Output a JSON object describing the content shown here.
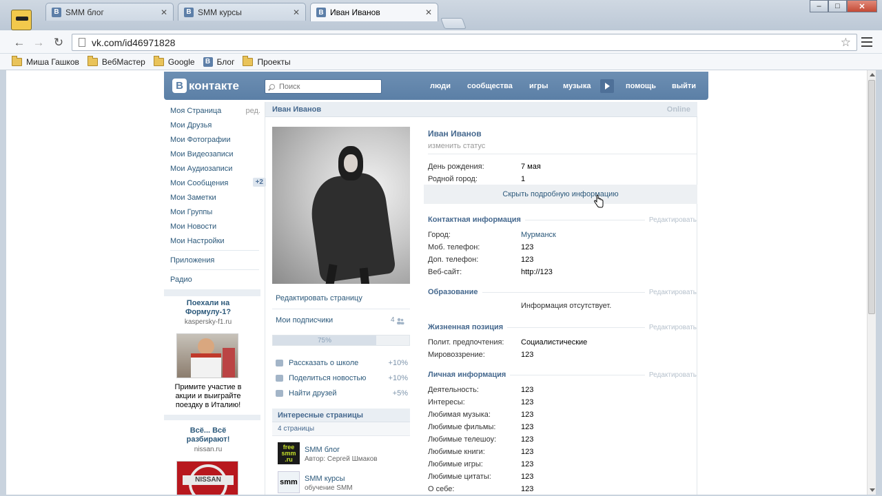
{
  "browser": {
    "tabs": [
      {
        "label": "SMM блог",
        "active": false
      },
      {
        "label": "SMM курсы",
        "active": false
      },
      {
        "label": "Иван Иванов",
        "active": true
      }
    ],
    "url": "vk.com/id46971828",
    "bookmarks": [
      {
        "label": "Миша Гашков",
        "icon": "folder-icon"
      },
      {
        "label": "ВебМастер",
        "icon": "folder-icon"
      },
      {
        "label": "Google",
        "icon": "folder-icon"
      },
      {
        "label": "Блог",
        "icon": "vk-favicon"
      },
      {
        "label": "Проекты",
        "icon": "folder-icon"
      }
    ],
    "window_controls": {
      "min": "–",
      "max": "□",
      "close": "✕"
    }
  },
  "vk": {
    "logo_letter": "В",
    "logo_text": "контакте",
    "search_placeholder": "Поиск",
    "nav": [
      "люди",
      "сообщества",
      "игры",
      "музыка",
      "помощь",
      "выйти"
    ],
    "left_menu": [
      {
        "label": "Моя Страница",
        "extra": "ред."
      },
      {
        "label": "Мои Друзья"
      },
      {
        "label": "Мои Фотографии"
      },
      {
        "label": "Мои Видеозаписи"
      },
      {
        "label": "Мои Аудиозаписи"
      },
      {
        "label": "Мои Сообщения",
        "count": "+2"
      },
      {
        "label": "Мои Заметки"
      },
      {
        "label": "Мои Группы"
      },
      {
        "label": "Мои Новости"
      },
      {
        "label": "Мои Настройки"
      }
    ],
    "left_menu_extra": [
      "Приложения",
      "Радио"
    ],
    "ads": [
      {
        "title": "Поехали на Формулу-1?",
        "domain": "kaspersky-f1.ru",
        "text": "Примите участие в акции и выиграйте поездку в Италию!"
      },
      {
        "title": "Всё... Всё разбирают!",
        "domain": "nissan.ru",
        "logo": "NISSAN"
      }
    ],
    "profile": {
      "header_name": "Иван Иванов",
      "online": "Online",
      "name": "Иван Иванов",
      "status": "изменить статус",
      "edit_page": "Редактировать страницу",
      "subscribers": {
        "label": "Мои подписчики",
        "count": "4"
      },
      "progress": {
        "label": "75%",
        "value": 75
      },
      "tasks": [
        {
          "label": "Рассказать о школе",
          "pct": "+10%"
        },
        {
          "label": "Поделиться новостью",
          "pct": "+10%"
        },
        {
          "label": "Найти друзей",
          "pct": "+5%"
        }
      ],
      "interesting": {
        "title": "Интересные страницы",
        "count": "4 страницы"
      },
      "pages": [
        {
          "title": "SMM блог",
          "sub": "Автор: Сергей Шмаков",
          "logo": "free smm .ru"
        },
        {
          "title": "SMM курсы",
          "sub": "обучение SMM",
          "logo": "smm"
        }
      ],
      "basic": [
        {
          "k": "День рождения:",
          "v": "7 мая"
        },
        {
          "k": "Родной город:",
          "v": "1"
        }
      ],
      "hide_details": "Скрыть подробную информацию",
      "edit_label": "Редактировать",
      "contact": {
        "title": "Контактная информация",
        "rows": [
          {
            "k": "Город:",
            "v": "Мурманск"
          },
          {
            "k": "Моб. телефон:",
            "v": "123"
          },
          {
            "k": "Доп. телефон:",
            "v": "123"
          },
          {
            "k": "Веб-сайт:",
            "v": "http://123"
          }
        ]
      },
      "education": {
        "title": "Образование",
        "empty": "Информация отсутствует."
      },
      "life": {
        "title": "Жизненная позиция",
        "rows": [
          {
            "k": "Полит. предпочтения:",
            "v": "Социалистические"
          },
          {
            "k": "Мировоззрение:",
            "v": "123"
          }
        ]
      },
      "personal": {
        "title": "Личная информация",
        "rows": [
          {
            "k": "Деятельность:",
            "v": "123"
          },
          {
            "k": "Интересы:",
            "v": "123"
          },
          {
            "k": "Любимая музыка:",
            "v": "123"
          },
          {
            "k": "Любимые фильмы:",
            "v": "123"
          },
          {
            "k": "Любимые телешоу:",
            "v": "123"
          },
          {
            "k": "Любимые книги:",
            "v": "123"
          },
          {
            "k": "Любимые игры:",
            "v": "123"
          },
          {
            "k": "Любимые цитаты:",
            "v": "123"
          },
          {
            "k": "О себе:",
            "v": "123"
          }
        ]
      }
    }
  }
}
